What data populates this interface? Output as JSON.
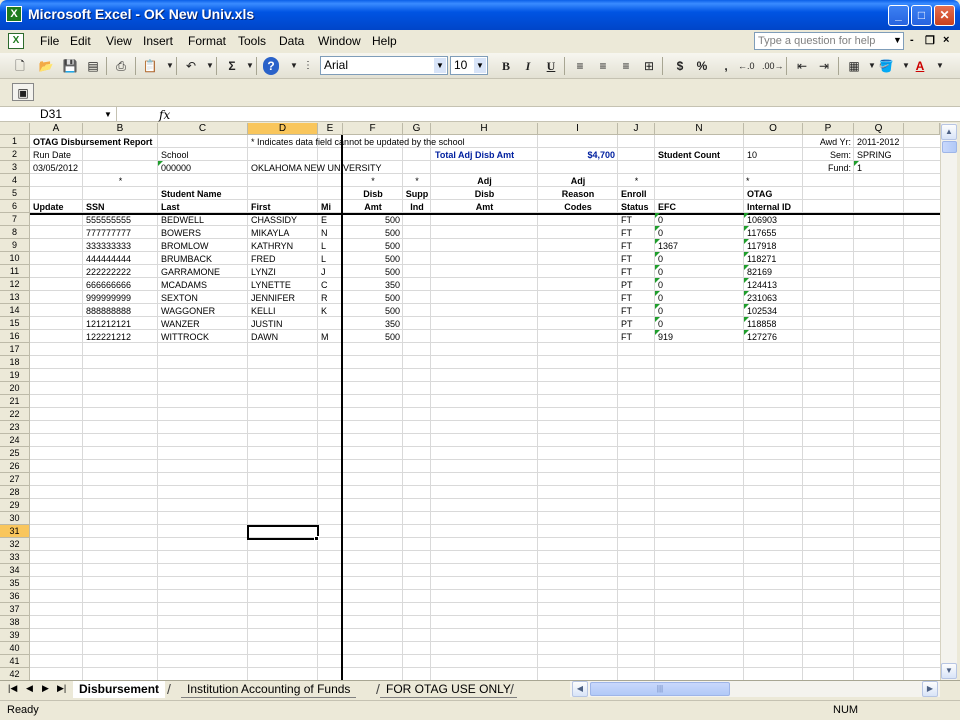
{
  "window": {
    "title": "Microsoft Excel - OK New Univ.xls",
    "min": "_",
    "max": "□",
    "close": "✕",
    "app_icon": "excel-icon"
  },
  "menu": [
    {
      "id": "file",
      "label": "File"
    },
    {
      "id": "edit",
      "label": "Edit"
    },
    {
      "id": "view",
      "label": "View"
    },
    {
      "id": "insert",
      "label": "Insert"
    },
    {
      "id": "format",
      "label": "Format"
    },
    {
      "id": "tools",
      "label": "Tools"
    },
    {
      "id": "data",
      "label": "Data"
    },
    {
      "id": "window",
      "label": "Window"
    },
    {
      "id": "help",
      "label": "Help"
    }
  ],
  "help_search": {
    "placeholder": "Type a question for help"
  },
  "toolbar": {
    "font_name": "Arial",
    "font_size": "10",
    "bold": "B",
    "italic": "I",
    "underline": "U",
    "currency": "$",
    "percent": "%",
    "comma": ",",
    "sigma": "Σ",
    "help_q": "?"
  },
  "formula_bar": {
    "name_box": "D31",
    "fx": "fx",
    "content": ""
  },
  "columns": [
    "A",
    "B",
    "C",
    "D",
    "E",
    "F",
    "G",
    "H",
    "I",
    "J",
    "N",
    "O",
    "P",
    "Q"
  ],
  "selected_column": "D",
  "selected_row": "31",
  "rows": [
    "1",
    "2",
    "3",
    "4",
    "5",
    "6",
    "7",
    "8",
    "9",
    "10",
    "11",
    "12",
    "13",
    "14",
    "15",
    "16",
    "17",
    "18",
    "19",
    "20",
    "21",
    "22",
    "23",
    "24",
    "25",
    "26",
    "27",
    "28",
    "29",
    "30",
    "31",
    "32",
    "33",
    "34",
    "35",
    "36",
    "37",
    "38",
    "39",
    "40",
    "41",
    "42"
  ],
  "sheet": {
    "title": "OTAG Disbursement Report",
    "note": "* Indicates data field cannot be updated by the school",
    "awd_yr_label": "Awd Yr:",
    "awd_yr": "2011-2012",
    "run_date_label": "Run Date",
    "school_label": "School",
    "total_label": "Total Adj Disb Amt",
    "total_value": "$4,700",
    "student_count_label": "Student Count",
    "student_count": "10",
    "sem_label": "Sem:",
    "sem": "SPRING",
    "run_date": "03/05/2012",
    "school_code": "000000",
    "school_name": "OKLAHOMA NEW UNIVERSITY",
    "fund_label": "Fund:",
    "fund": "1",
    "star": "*",
    "h_student_name": "Student Name",
    "h_adj1": "Adj",
    "h_adj2": "Adj",
    "h_disb1": "Disb",
    "h_supp": "Supp",
    "h_disb2": "Disb",
    "h_reason": "Reason",
    "h_enroll": "Enroll",
    "h_otag": "OTAG",
    "h_update": "Update",
    "h_ssn": "SSN",
    "h_last": "Last",
    "h_first": "First",
    "h_mi": "Mi",
    "h_amt1": "Amt",
    "h_ind": "Ind",
    "h_amt2": "Amt",
    "h_codes": "Codes",
    "h_status": "Status",
    "h_efc": "EFC",
    "h_internal_id": "Internal ID"
  },
  "students": [
    {
      "ssn": "555555555",
      "last": "BEDWELL",
      "first": "CHASSIDY",
      "mi": "E",
      "disb_amt": "500",
      "status": "FT",
      "efc": "0",
      "id": "106903"
    },
    {
      "ssn": "777777777",
      "last": "BOWERS",
      "first": "MIKAYLA",
      "mi": "N",
      "disb_amt": "500",
      "status": "FT",
      "efc": "0",
      "id": "117655"
    },
    {
      "ssn": "333333333",
      "last": "BROMLOW",
      "first": "KATHRYN",
      "mi": "L",
      "disb_amt": "500",
      "status": "FT",
      "efc": "1367",
      "id": "117918"
    },
    {
      "ssn": "444444444",
      "last": "BRUMBACK",
      "first": "FRED",
      "mi": "L",
      "disb_amt": "500",
      "status": "FT",
      "efc": "0",
      "id": "118271"
    },
    {
      "ssn": "222222222",
      "last": "GARRAMONE",
      "first": "LYNZI",
      "mi": "J",
      "disb_amt": "500",
      "status": "FT",
      "efc": "0",
      "id": "82169"
    },
    {
      "ssn": "666666666",
      "last": "MCADAMS",
      "first": "LYNETTE",
      "mi": "C",
      "disb_amt": "350",
      "status": "PT",
      "efc": "0",
      "id": "124413"
    },
    {
      "ssn": "999999999",
      "last": "SEXTON",
      "first": "JENNIFER",
      "mi": "R",
      "disb_amt": "500",
      "status": "FT",
      "efc": "0",
      "id": "231063"
    },
    {
      "ssn": "888888888",
      "last": "WAGGONER",
      "first": "KELLI",
      "mi": "K",
      "disb_amt": "500",
      "status": "FT",
      "efc": "0",
      "id": "102534"
    },
    {
      "ssn": "121212121",
      "last": "WANZER",
      "first": "JUSTIN",
      "mi": "",
      "disb_amt": "350",
      "status": "PT",
      "efc": "0",
      "id": "118858"
    },
    {
      "ssn": "122221212",
      "last": "WITTROCK",
      "first": "DAWN",
      "mi": "M",
      "disb_amt": "500",
      "status": "FT",
      "efc": "919",
      "id": "127276"
    }
  ],
  "tabs": [
    {
      "label": "Disbursement",
      "active": true
    },
    {
      "label": "Institution Accounting of Funds",
      "active": false
    },
    {
      "label": "FOR OTAG USE ONLY",
      "active": false
    }
  ],
  "status": {
    "text": "Ready",
    "num": "NUM"
  }
}
